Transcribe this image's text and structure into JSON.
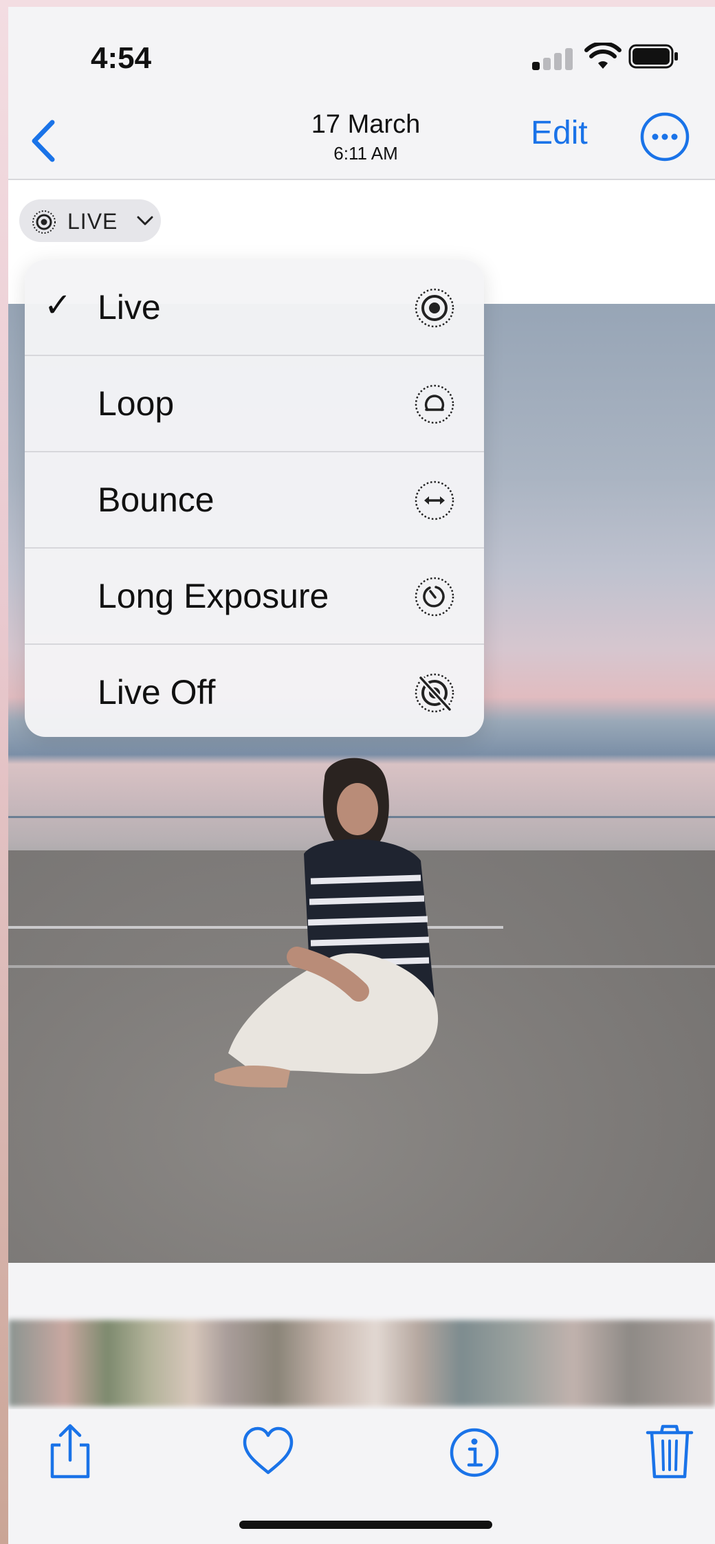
{
  "status_bar": {
    "time": "4:54"
  },
  "nav": {
    "date": "17 March",
    "time": "6:11 AM",
    "edit_label": "Edit"
  },
  "live_button": {
    "label": "LIVE"
  },
  "menu": {
    "items": [
      {
        "label": "Live",
        "checked": true,
        "icon": "live-icon"
      },
      {
        "label": "Loop",
        "checked": false,
        "icon": "loop-icon"
      },
      {
        "label": "Bounce",
        "checked": false,
        "icon": "bounce-icon"
      },
      {
        "label": "Long Exposure",
        "checked": false,
        "icon": "long-exposure-icon"
      },
      {
        "label": "Live Off",
        "checked": false,
        "icon": "live-off-icon"
      }
    ],
    "check_glyph": "✓"
  },
  "colors": {
    "accent": "#1a73e8",
    "text": "#111111",
    "menu_bg": "#f4f4f6"
  },
  "toolbar": {
    "icons": [
      "share-icon",
      "heart-icon",
      "info-icon",
      "trash-icon"
    ]
  }
}
